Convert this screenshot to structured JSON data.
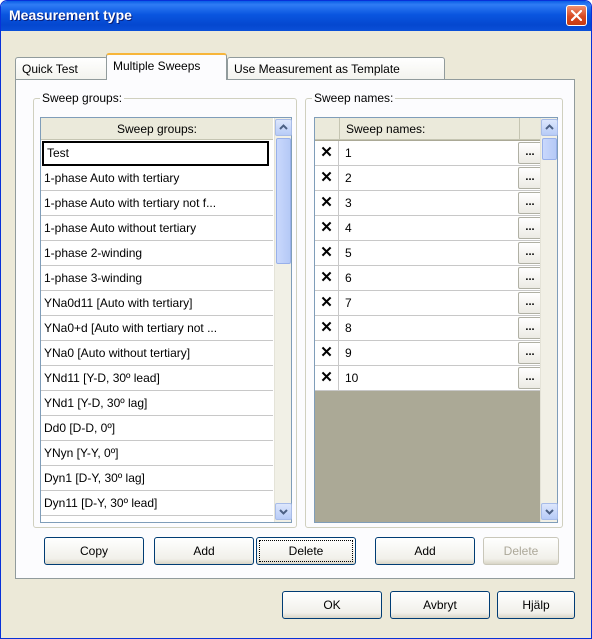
{
  "window": {
    "title": "Measurement type"
  },
  "tabs": [
    {
      "label": "Quick Test"
    },
    {
      "label": "Multiple Sweeps"
    },
    {
      "label": "Use Measurement as Template"
    }
  ],
  "sweep_groups": {
    "legend": "Sweep groups:",
    "header": "Sweep groups:",
    "items": [
      "Test",
      "1-phase Auto with tertiary",
      "1-phase Auto with tertiary not f...",
      "1-phase Auto without tertiary",
      "1-phase 2-winding",
      "1-phase 3-winding",
      "YNa0d11 [Auto with tertiary]",
      "YNa0+d [Auto with tertiary not ...",
      "YNa0 [Auto without tertiary]",
      "YNd11 [Y-D, 30º lead]",
      "YNd1 [Y-D, 30º lag]",
      "Dd0 [D-D, 0º]",
      "YNyn [Y-Y, 0º]",
      "Dyn1 [D-Y, 30º lag]",
      "Dyn11 [D-Y, 30º lead]"
    ]
  },
  "sweep_names": {
    "legend": "Sweep names:",
    "header": "Sweep names:",
    "delete_glyph": "✕",
    "ellipsis_label": "...",
    "items": [
      "1",
      "2",
      "3",
      "4",
      "5",
      "6",
      "7",
      "8",
      "9",
      "10"
    ]
  },
  "buttons": {
    "copy": "Copy",
    "add_group": "Add",
    "delete_group": "Delete",
    "add_name": "Add",
    "delete_name": "Delete",
    "ok": "OK",
    "cancel": "Avbryt",
    "help": "Hjälp"
  }
}
